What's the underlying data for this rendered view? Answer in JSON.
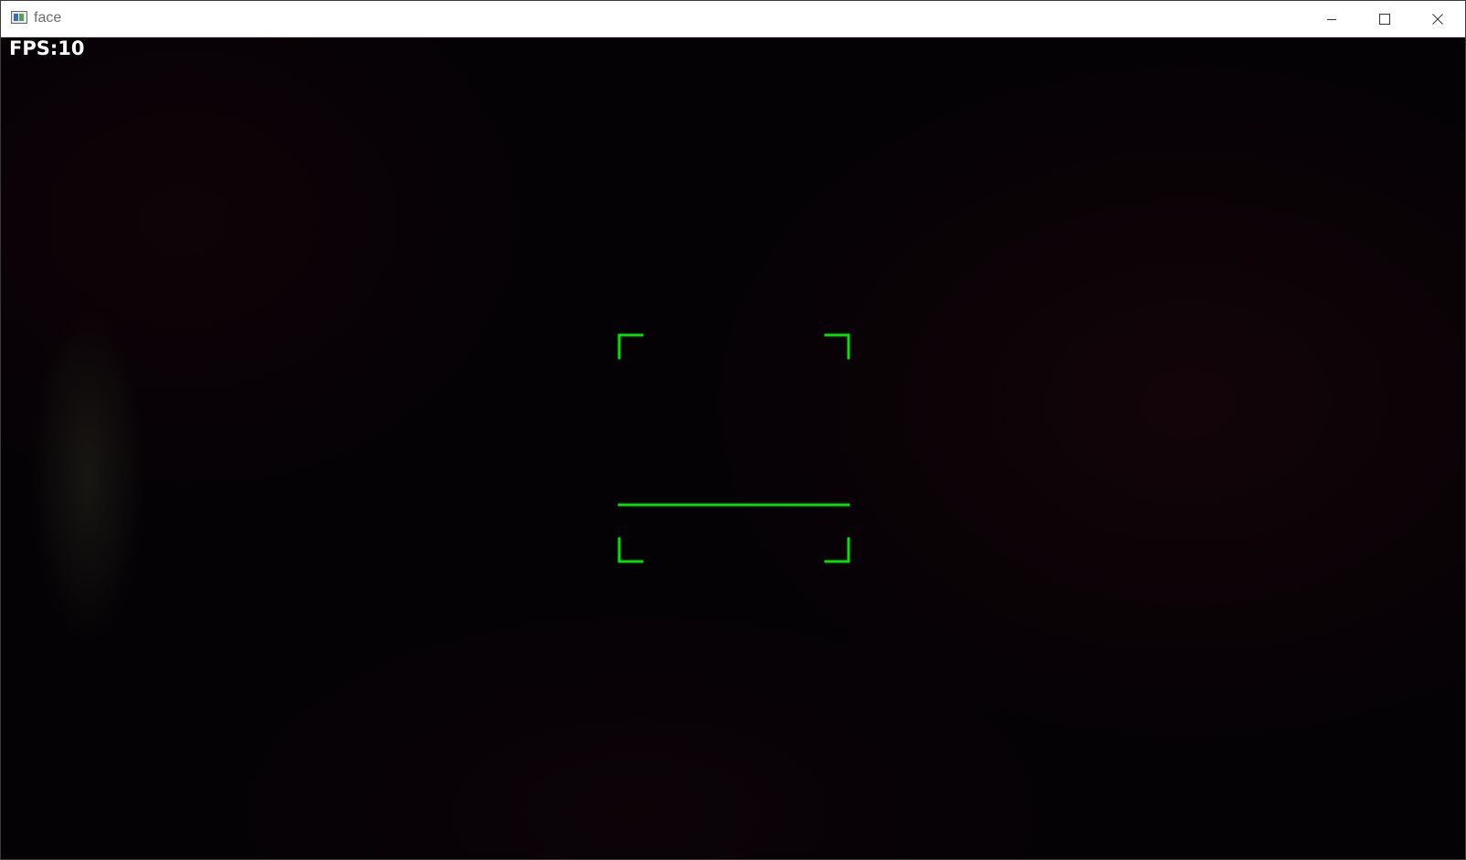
{
  "window": {
    "title": "face",
    "buttons": {
      "minimize": "minimize-icon",
      "maximize": "maximize-icon",
      "close": "close-icon"
    }
  },
  "video": {
    "fps_label": "FPS:10",
    "overlay_color": "#00e600",
    "overlay_shape": "face-guide-brackets-with-horizontal-line"
  }
}
